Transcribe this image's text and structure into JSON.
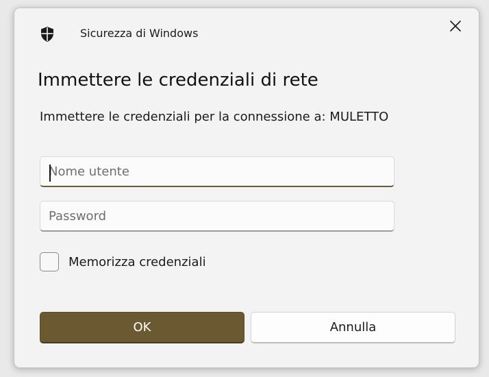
{
  "window": {
    "app_title": "Sicurezza di Windows",
    "icon": "shield-icon",
    "close_icon": "close-icon"
  },
  "dialog": {
    "heading": "Immettere le credenziali di rete",
    "subtitle": "Immettere le credenziali per la connessione a: MULETTO"
  },
  "form": {
    "username": {
      "value": "",
      "placeholder": "Nome utente"
    },
    "password": {
      "value": "",
      "placeholder": "Password"
    },
    "remember": {
      "label": "Memorizza credenziali",
      "checked": false
    }
  },
  "buttons": {
    "ok_label": "OK",
    "cancel_label": "Annulla"
  },
  "colors": {
    "accent": "#6b5a31",
    "background": "#f3f3f3"
  }
}
